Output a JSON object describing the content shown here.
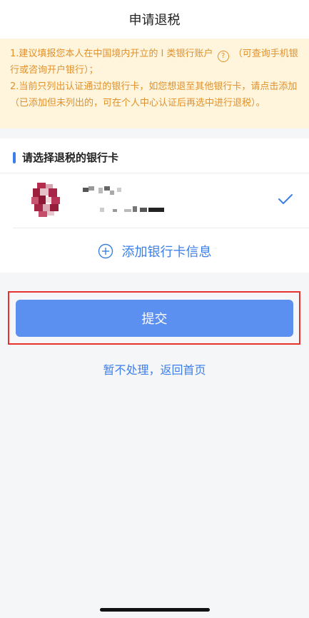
{
  "header": {
    "title": "申请退税"
  },
  "notice": {
    "line1_before": "1.建议填报您本人在中国境内开立的 I 类银行账户",
    "help_symbol": "?",
    "line1_after": "（可查询手机银行或咨询开户银行）；",
    "line2": "2.当前只列出认证通过的银行卡，如您想退至其他银行卡，请点击添加（已添加但未列出的，可在个人中心认证后再选中进行退税）。"
  },
  "card_section": {
    "title": "请选择退税的银行卡",
    "selected_bank": {
      "selected": true
    },
    "add_card_label": "添加银行卡信息"
  },
  "actions": {
    "submit_label": "提交",
    "return_label": "暂不处理，返回首页"
  },
  "colors": {
    "accent": "#3d7fe9",
    "button": "#5b8ff0",
    "notice_text": "#e1912b",
    "notice_bg": "#fff5dc",
    "highlight_border": "#e8322f"
  },
  "icons": {
    "help": "question-circle-icon",
    "check": "check-icon",
    "add": "plus-circle-icon",
    "bank_logo": "bank-logo-icon"
  }
}
